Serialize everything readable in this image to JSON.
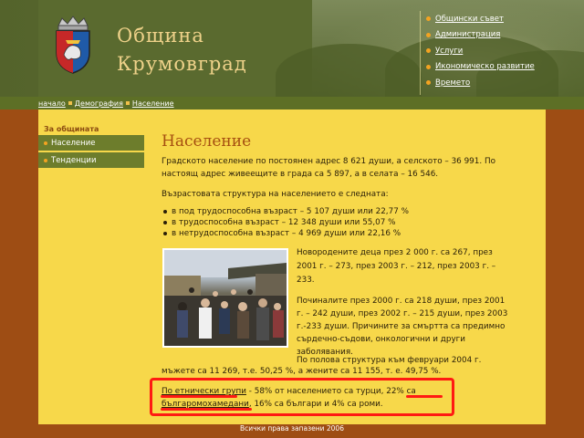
{
  "header": {
    "title_line1": "Община",
    "title_line2": "Крумовград",
    "nav": [
      {
        "label": "Общински съвет"
      },
      {
        "label": "Администрация"
      },
      {
        "label": "Услуги"
      },
      {
        "label": "Икономическо развитие"
      },
      {
        "label": "Времето"
      }
    ]
  },
  "breadcrumb": [
    "начало",
    "Демография",
    "Население"
  ],
  "sidebar": {
    "title": "За общината",
    "items": [
      {
        "label": "Население"
      },
      {
        "label": "Тенденции"
      }
    ]
  },
  "main": {
    "title": "Население",
    "intro_line1": "Градското население по постоянен адрес 8 621 души, а селското – 36 991. По",
    "intro_line2": "настоящ адрес живеещите в града са 5 897, а в селата – 16 546.",
    "age_heading": "Възрастовата структура на населението е следната:",
    "age_items": [
      "в под трудоспособна възраст – 5 107 души или 22,77 %",
      "в трудоспособна възраст – 12 348 души или 55,07 %",
      "в нетрудоспособна възраст – 4 969 души или 22,16 %"
    ],
    "births_line1": "Новородените деца през 2 000 г. са 267, през",
    "births_line2": "2001 г. – 273, през 2003 г. – 212, през 2003 г. –",
    "births_line3": "233.",
    "deaths_line1": "Починалите през 2000 г. са 218 души, през 2001",
    "deaths_line2": "г. – 242 души, през 2002 г. – 215 души, през 2003",
    "deaths_line3": "г.-233 души. Причините за смъртта са предимно",
    "deaths_line4": "сърдечно-съдови, онкологични и други",
    "deaths_line5": "заболявания.",
    "gender_line1": "По полова структура към февруари 2004 г.",
    "gender_line2": "мъжете са 11 269, т.е. 50,25 %, а жените са 11 155, т. е. 49,75 %.",
    "ethnic_part1": "По етнически групи",
    "ethnic_part2": " - 58% от населението са турци, ",
    "ethnic_part3": "22% са",
    "ethnic_part4": "българомохамедани",
    "ethnic_part5": ", 16% са българи и 4% са роми."
  },
  "footer": {
    "copyright": "Всички права запазени 2006"
  },
  "colors": {
    "header_green": "#5a6a2f",
    "content_yellow": "#f7d84a",
    "page_brown": "#9e4d14",
    "title_color": "#a64f10",
    "highlight_red": "#ff1a12"
  }
}
